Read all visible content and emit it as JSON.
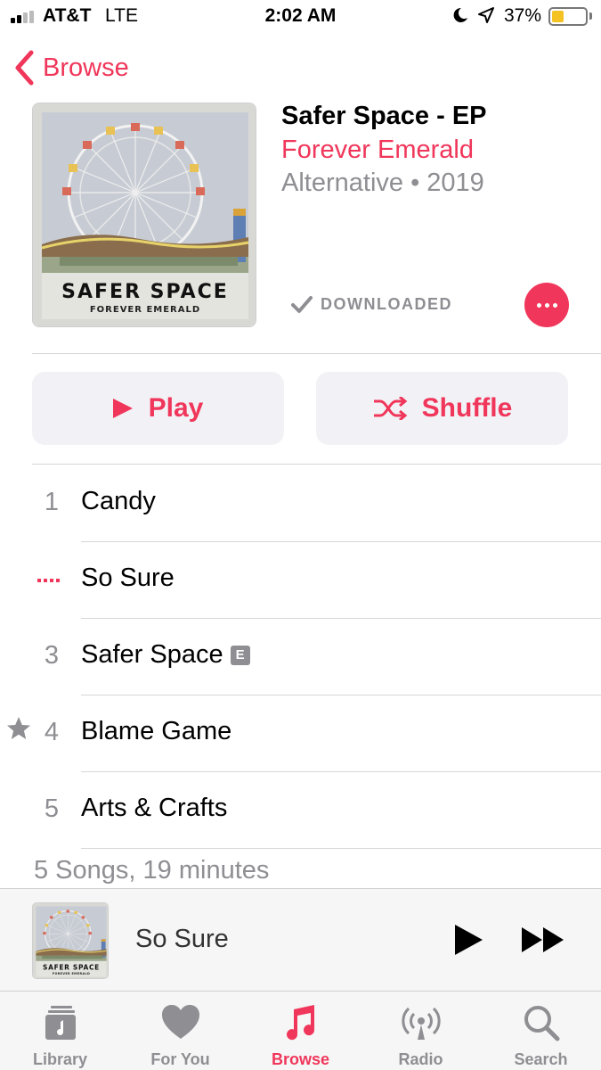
{
  "status_bar": {
    "carrier": "AT&T",
    "network": "LTE",
    "time": "2:02 AM",
    "battery_percent": "37%",
    "icons": [
      "signal-icon",
      "moon-icon",
      "location-icon",
      "battery-icon"
    ],
    "battery_level": 0.37
  },
  "nav": {
    "back_label": "Browse"
  },
  "album": {
    "title": "Safer Space - EP",
    "artist": "Forever Emerald",
    "meta": "Alternative • 2019",
    "cover_title": "SAFER SPACE",
    "cover_artist": "FOREVER EMERALD",
    "downloaded_label": "DOWNLOADED"
  },
  "actions": {
    "play_label": "Play",
    "shuffle_label": "Shuffle"
  },
  "tracks": [
    {
      "number": "1",
      "title": "Candy"
    },
    {
      "number": "",
      "title": "So Sure",
      "now_playing": true
    },
    {
      "number": "3",
      "title": "Safer Space",
      "explicit": "E"
    },
    {
      "number": "4",
      "title": "Blame Game",
      "starred": true
    },
    {
      "number": "5",
      "title": "Arts & Crafts"
    }
  ],
  "summary": "5 Songs, 19 minutes",
  "mini_player": {
    "title": "So Sure"
  },
  "tabs": [
    {
      "label": "Library",
      "icon": "library-icon"
    },
    {
      "label": "For You",
      "icon": "heart-icon"
    },
    {
      "label": "Browse",
      "icon": "music-note-icon",
      "active": true
    },
    {
      "label": "Radio",
      "icon": "radio-icon"
    },
    {
      "label": "Search",
      "icon": "search-icon"
    }
  ],
  "colors": {
    "accent": "#f0365a",
    "secondary_text": "#8e8e93",
    "battery": "#f5c224"
  }
}
